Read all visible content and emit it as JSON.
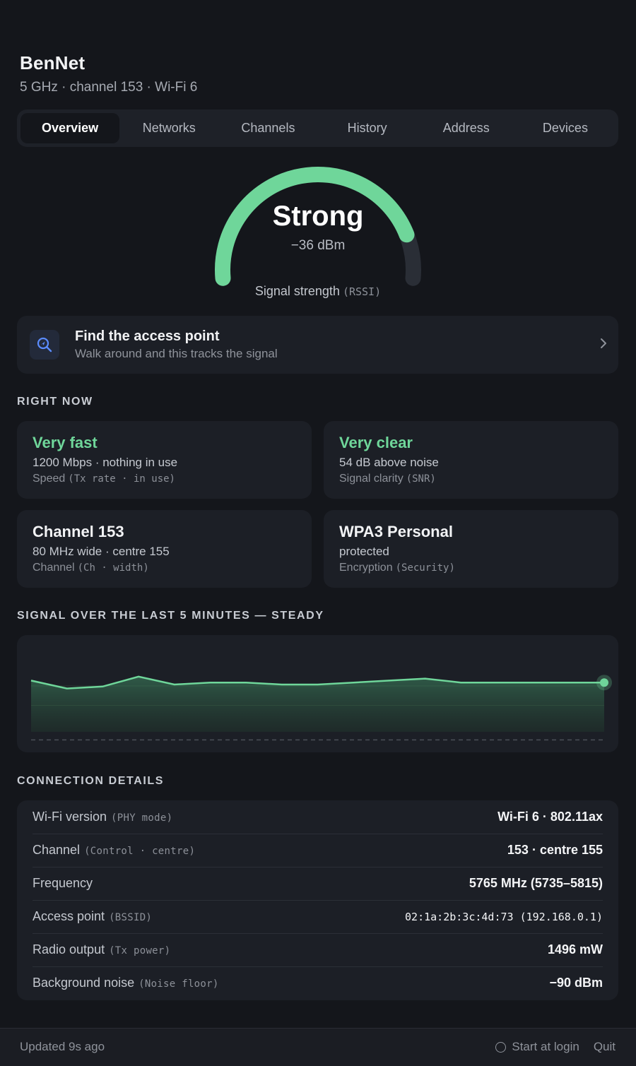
{
  "network": {
    "name": "BenNet",
    "subtitle": "5 GHz · channel 153 · Wi-Fi 6"
  },
  "tabs": [
    {
      "label": "Overview",
      "active": true
    },
    {
      "label": "Networks",
      "active": false
    },
    {
      "label": "Channels",
      "active": false
    },
    {
      "label": "History",
      "active": false
    },
    {
      "label": "Address",
      "active": false
    },
    {
      "label": "Devices",
      "active": false
    }
  ],
  "gauge": {
    "status": "Strong",
    "value": "−36 dBm",
    "fill_fraction": 0.86,
    "caption": "Signal strength",
    "caption_tech": "(RSSI)",
    "color": "#6fd69a"
  },
  "find_card": {
    "title": "Find the access point",
    "subtitle": "Walk around and this tracks the signal",
    "icon": "search-location-icon",
    "chevron": "chevron-right-icon"
  },
  "sections": {
    "right_now": "RIGHT NOW",
    "signal_history": "SIGNAL OVER THE LAST 5 MINUTES — STEADY",
    "connection_details": "CONNECTION DETAILS"
  },
  "stats": [
    {
      "main": "Very fast",
      "desc": "1200 Mbps · nothing in use",
      "label": "Speed",
      "tech": "(Tx rate · in use)"
    },
    {
      "main": "Very clear",
      "desc": "54 dB above noise",
      "label": "Signal clarity",
      "tech": "(SNR)"
    },
    {
      "main": "Channel 153",
      "desc": "80 MHz wide · centre 155",
      "label": "Channel",
      "tech": "(Ch · width)"
    },
    {
      "main": "WPA3 Personal",
      "desc": "protected",
      "label": "Encryption",
      "tech": "(Security)"
    }
  ],
  "chart_data": {
    "type": "area",
    "series": [
      {
        "values": [
          -36.8,
          -37.2,
          -37.1,
          -36.6,
          -37.0,
          -36.9,
          -36.9,
          -37.0,
          -37.0,
          -36.9,
          -36.8,
          -36.7,
          -36.9,
          -36.9,
          -36.9,
          -36.9,
          -36.9
        ]
      }
    ],
    "ylim": [
      -40,
      -35
    ],
    "reference_line": -39.8,
    "color": "#6fd69a"
  },
  "details": [
    {
      "label": "Wi-Fi version",
      "tech": "(PHY mode)",
      "value": "Wi-Fi 6 · 802.11ax",
      "mono": false
    },
    {
      "label": "Channel",
      "tech": "(Control · centre)",
      "value": "153 · centre 155",
      "mono": false
    },
    {
      "label": "Frequency",
      "tech": "",
      "value": "5765 MHz (5735–5815)",
      "mono": false
    },
    {
      "label": "Access point",
      "tech": "(BSSID)",
      "value": "02:1a:2b:3c:4d:73 (192.168.0.1)",
      "mono": true
    },
    {
      "label": "Radio output",
      "tech": "(Tx power)",
      "value": "1496 mW",
      "mono": false
    },
    {
      "label": "Background noise",
      "tech": "(Noise floor)",
      "value": "−90 dBm",
      "mono": false
    }
  ],
  "footer": {
    "updated": "Updated 9s ago",
    "start_at_login": "Start at login",
    "quit": "Quit"
  }
}
